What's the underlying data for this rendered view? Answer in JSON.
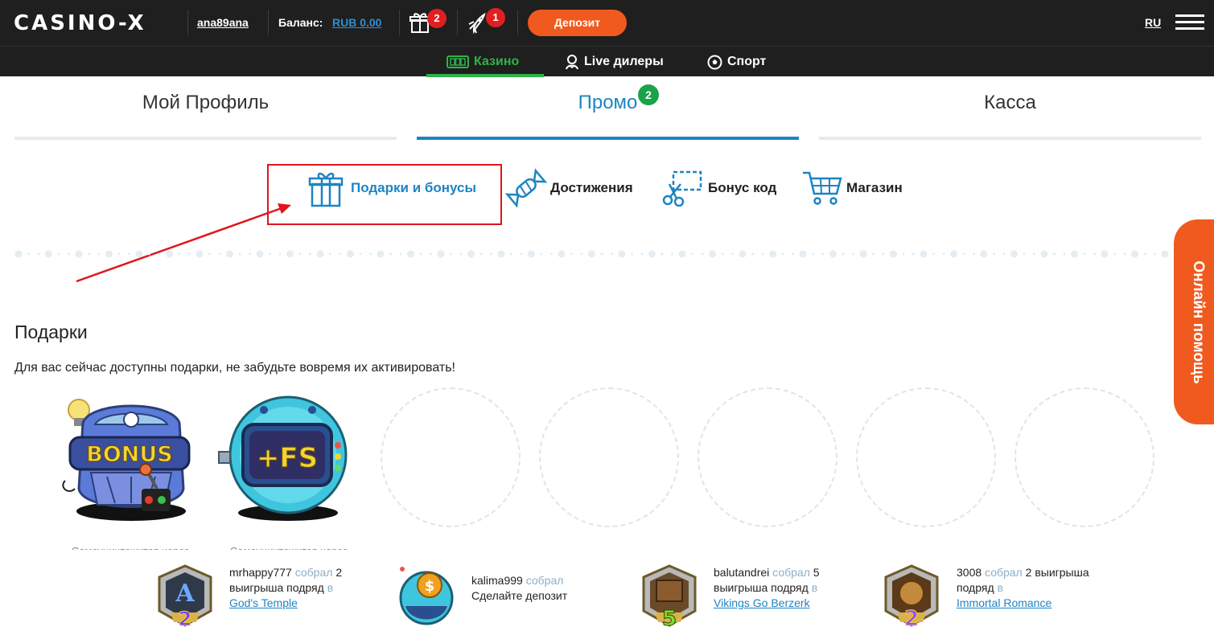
{
  "header": {
    "logo": "CASINO-X",
    "username": "ana89ana",
    "balance_label": "Баланс:",
    "balance_value": "RUB 0.00",
    "gifts_badge": "2",
    "rocket_badge": "1",
    "deposit_label": "Депозит",
    "language": "RU"
  },
  "nav": {
    "items": [
      {
        "label": "Казино",
        "icon": "slot-machine-icon"
      },
      {
        "label": "Live дилеры",
        "icon": "dealer-icon"
      },
      {
        "label": "Спорт",
        "icon": "soccer-ball-icon"
      }
    ]
  },
  "tabs": [
    {
      "label": "Мой Профиль"
    },
    {
      "label": "Промо",
      "badge": "2"
    },
    {
      "label": "Касса"
    }
  ],
  "subnav": [
    {
      "label": "Подарки и бонусы",
      "icon": "gift-icon"
    },
    {
      "label": "Достижения",
      "icon": "candy-icon"
    },
    {
      "label": "Бонус код",
      "icon": "scissors-coupon-icon"
    },
    {
      "label": "Магазин",
      "icon": "cart-icon"
    }
  ],
  "help_tab": "Онлайн помощь",
  "gifts": {
    "title": "Подарки",
    "description": "Для вас сейчас доступны подарки, не забудьте вовремя их активировать!",
    "items": [
      {
        "image_text": "BONUS",
        "caption": "Самоуничтожится через"
      },
      {
        "image_text": "+FS",
        "caption": "Самоуничтожится через"
      }
    ]
  },
  "feed": [
    {
      "user": "mrhappy777",
      "verb": "собрал",
      "text": "2 выигрыша подряд",
      "in": "в",
      "game": "God's Temple",
      "medal": "2"
    },
    {
      "user": "kalima999",
      "verb": "собрал",
      "text": "Сделайте депозит",
      "in": "",
      "game": "",
      "medal": "$"
    },
    {
      "user": "balutandrei",
      "verb": "собрал",
      "text": "5 выигрыша подряд",
      "in": "в",
      "game": "Vikings Go Berzerk",
      "medal": "5"
    },
    {
      "user": "3008",
      "verb": "собрал",
      "text": "2 выигрыша подряд",
      "in": "в",
      "game": "Immortal Romance",
      "medal": "2"
    }
  ],
  "colors": {
    "accent_orange": "#f15a1e",
    "accent_blue": "#1d84c4",
    "accent_green": "#2fb24a",
    "header_bg": "#1f1f1f",
    "highlight_red": "#e0141e"
  }
}
